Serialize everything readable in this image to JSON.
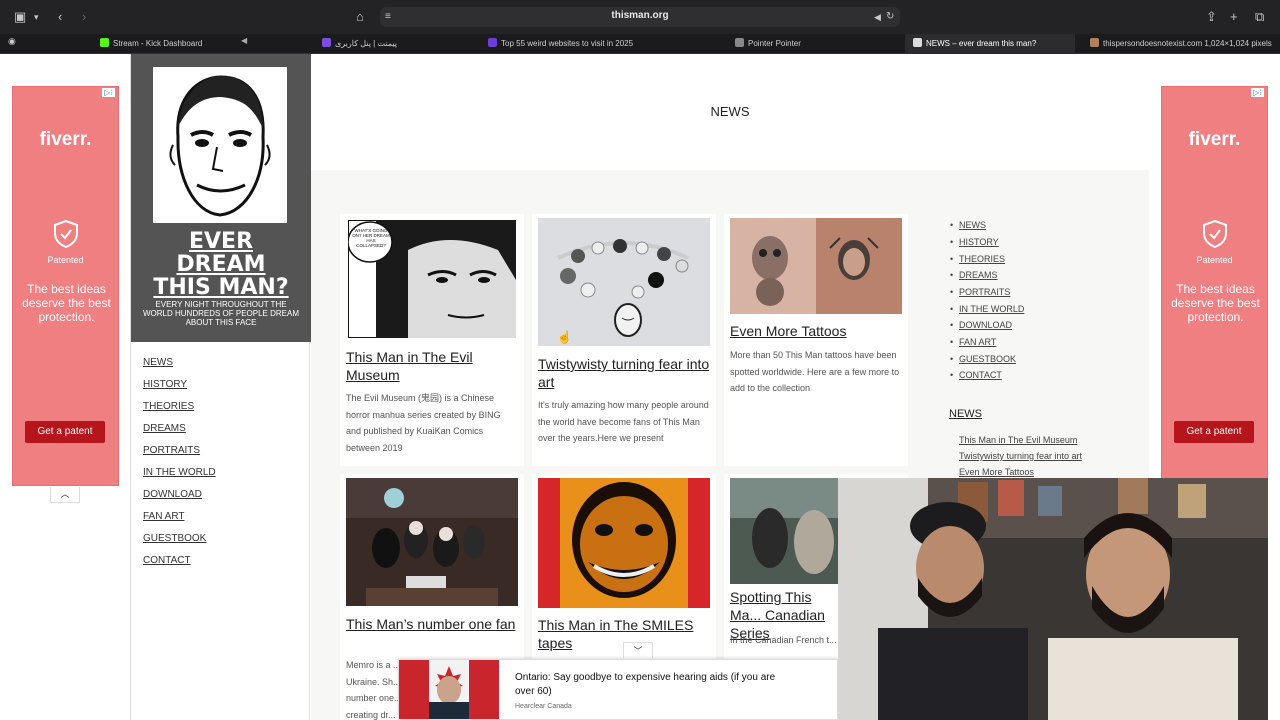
{
  "browser": {
    "url": "thisman.org",
    "tabs": [
      {
        "label": "Stream - Kick Dashboard",
        "color": "#53fc18"
      },
      {
        "label": "پیمنت | پنل کاربری",
        "color": "#7b4de0"
      },
      {
        "label": "Top 55 weird websites to visit in 2025",
        "color": "#6b3fd6"
      },
      {
        "label": "Pointer Pointer",
        "color": "#888888"
      },
      {
        "label": "NEWS – ever dream this man?",
        "color": "#dddddd"
      },
      {
        "label": "thispersondoesnotexist.com 1,024×1,024 pixels",
        "color": "#b08060"
      }
    ]
  },
  "ads": {
    "left": {
      "logo": "fiverr.",
      "patented": "Patented",
      "headline": "The best ideas deserve the best protection.",
      "button": "Get a patent"
    },
    "right": {
      "logo": "fiverr.",
      "patented": "Patented",
      "headline": "The best ideas deserve the best protection.",
      "button": "Get a patent"
    },
    "collapse_icon": "chevron-up-icon"
  },
  "site": {
    "title_lines": [
      "EVER",
      "DREAM",
      "THIS MAN?"
    ],
    "tagline": "EVERY NIGHT THROUGHOUT THE WORLD HUNDREDS OF PEOPLE DREAM ABOUT THIS FACE",
    "nav": [
      "NEWS",
      "HISTORY",
      "THEORIES",
      "DREAMS",
      "PORTRAITS",
      "IN THE WORLD",
      "DOWNLOAD",
      "FAN ART",
      "GUESTBOOK",
      "CONTACT"
    ]
  },
  "main": {
    "heading": "NEWS",
    "posts": [
      {
        "title": "This Man in The Evil Museum",
        "excerpt": "The Evil Museum (鬼园) is a Chinese horror manhua series created by BING and published by KuaiKan Comics between 2019",
        "bubble": "WHAT'S GOING ON? HER DREAM HAS COLLAPSED?"
      },
      {
        "title": "Twistywisty turning fear into art",
        "excerpt": "It's truly amazing how many people around the world have become fans of This Man over the years.Here we present"
      },
      {
        "title": "Even More Tattoos",
        "excerpt": "More than 50 This Man tattoos have been spotted worldwide. Here are a few more to add to the collection"
      },
      {
        "title": "This Man’s number one fan",
        "excerpt": "Memro is a ... Ukraine. Sh... number one... creating dr..."
      },
      {
        "title": "This Man in The SMILES tapes",
        "excerpt": ""
      },
      {
        "title": "Spotting This Ma... Canadian Series",
        "excerpt": "In the Canadian French t..."
      }
    ]
  },
  "sidebar": {
    "nav": [
      "NEWS",
      "HISTORY",
      "THEORIES",
      "DREAMS",
      "PORTRAITS",
      "IN THE WORLD",
      "DOWNLOAD",
      "FAN ART",
      "GUESTBOOK",
      "CONTACT"
    ],
    "news_heading": "NEWS",
    "recent": [
      "This Man in The Evil Museum",
      "Twistywisty turning fear into art",
      "Even More Tattoos"
    ]
  },
  "bottom_ad": {
    "headline": "Ontario: Say goodbye to expensive hearing aids (if you are over 60)",
    "source": "Hearclear Canada",
    "toggle_icon": "chevron-down-icon"
  },
  "colors": {
    "ad_bg": "#f07f82",
    "ad_button": "#b5151b",
    "logo_bg": "#545454"
  }
}
